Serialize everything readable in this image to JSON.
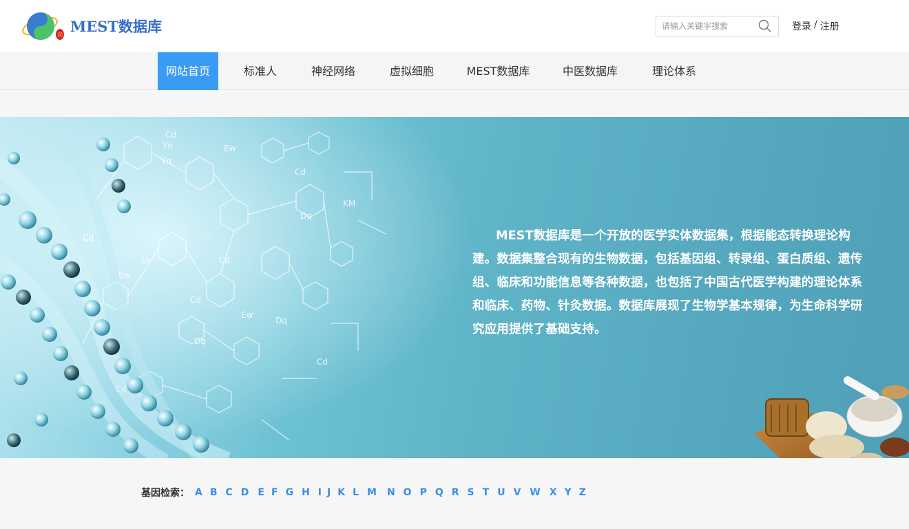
{
  "header": {
    "logo_text": "MEST数据库",
    "search_placeholder": "请输入关键字搜索",
    "login_label": "登录",
    "separator": "/",
    "register_label": "注册"
  },
  "nav": {
    "items": [
      {
        "label": "网站首页",
        "active": true
      },
      {
        "label": "标准人",
        "active": false
      },
      {
        "label": "神经网络",
        "active": false
      },
      {
        "label": "虚拟细胞",
        "active": false
      },
      {
        "label": "MEST数据库",
        "active": false
      },
      {
        "label": "中医数据库",
        "active": false
      },
      {
        "label": "理论体系",
        "active": false
      }
    ]
  },
  "banner": {
    "description": "MEST数据库是一个开放的医学实体数据集，根据能态转换理论构建。数据集整合现有的生物数据，包括基因组、转录组、蛋白质组、遗传组、临床和功能信息等各种数据，也包括了中国古代医学构建的理论体系和临床、药物、针灸数据。数据库展现了生物学基本规律，为生命科学研究应用提供了基础支持。",
    "molecule_labels": [
      "Cd",
      "Ew",
      "Yn",
      "Cd",
      "Dq",
      "KM",
      "Cd",
      "Ew",
      "Lk",
      "Cd",
      "Dq",
      "Cd",
      "Yn",
      "Ew",
      "Cd",
      "Dq",
      "Cd"
    ]
  },
  "gene_index": {
    "label": "基因检索：",
    "letters": [
      "A",
      "B",
      "C",
      "D",
      "E",
      "F",
      "G",
      "H",
      "I",
      "J",
      "K",
      "L",
      "M",
      "N",
      "O",
      "P",
      "Q",
      "R",
      "S",
      "T",
      "U",
      "V",
      "W",
      "X",
      "Y",
      "Z"
    ]
  },
  "colors": {
    "accent": "#3a9bf5",
    "letter_link": "#3a8ee6",
    "banner_teal": "#56a9bf"
  }
}
